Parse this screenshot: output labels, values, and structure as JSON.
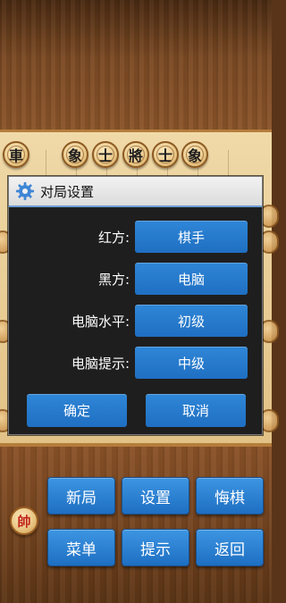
{
  "top_pieces": [
    {
      "char": "車",
      "color": "black"
    },
    {
      "char": "象",
      "color": "black"
    },
    {
      "char": "士",
      "color": "black"
    },
    {
      "char": "將",
      "color": "black"
    },
    {
      "char": "士",
      "color": "black"
    },
    {
      "char": "象",
      "color": "black"
    }
  ],
  "dialog": {
    "title": "对局设置",
    "rows": [
      {
        "label": "红方:",
        "value": "棋手"
      },
      {
        "label": "黑方:",
        "value": "电脑"
      },
      {
        "label": "电脑水平:",
        "value": "初级"
      },
      {
        "label": "电脑提示:",
        "value": "中级"
      }
    ],
    "confirm": "确定",
    "cancel": "取消"
  },
  "bottom_piece": {
    "char": "帥",
    "color": "red"
  },
  "menu": {
    "new_game": "新局",
    "settings": "设置",
    "undo": "悔棋",
    "main_menu": "菜单",
    "hint": "提示",
    "back": "返回"
  },
  "colors": {
    "accent_blue": "#1f6fc2",
    "dialog_bg": "#1e1e1e",
    "wood": "#7a4822",
    "board": "#e9cd96"
  }
}
